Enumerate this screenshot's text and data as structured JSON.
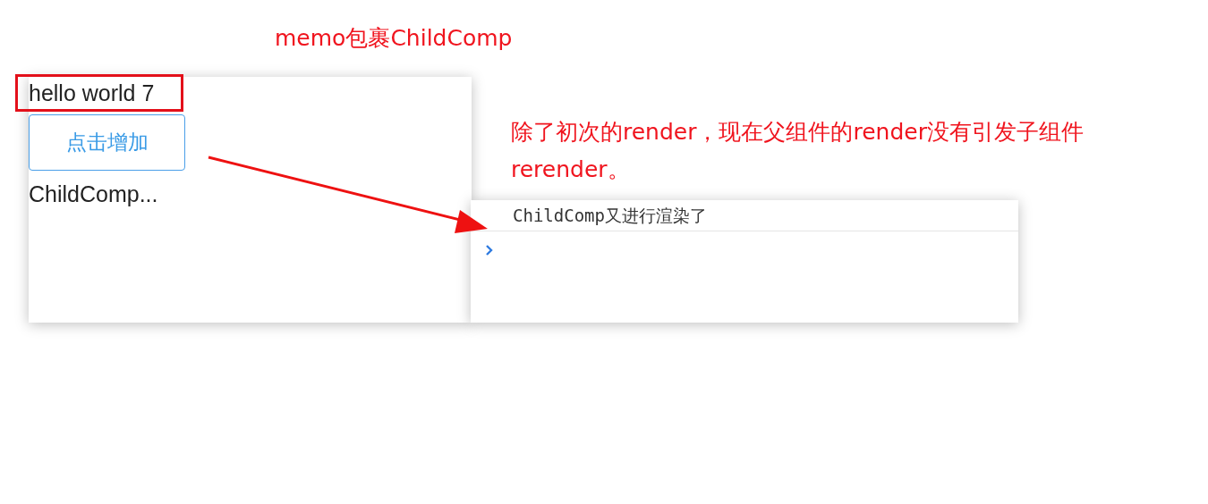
{
  "title": "memo包裹ChildComp",
  "app_panel": {
    "heading": "hello world 7",
    "highlighted": true,
    "button": "点击增加",
    "child_text": "ChildComp..."
  },
  "note": "除了初次的render，现在父组件的render没有引发子组件rerender。",
  "console": {
    "messages": [
      "ChildComp又进行渲染了"
    ]
  }
}
